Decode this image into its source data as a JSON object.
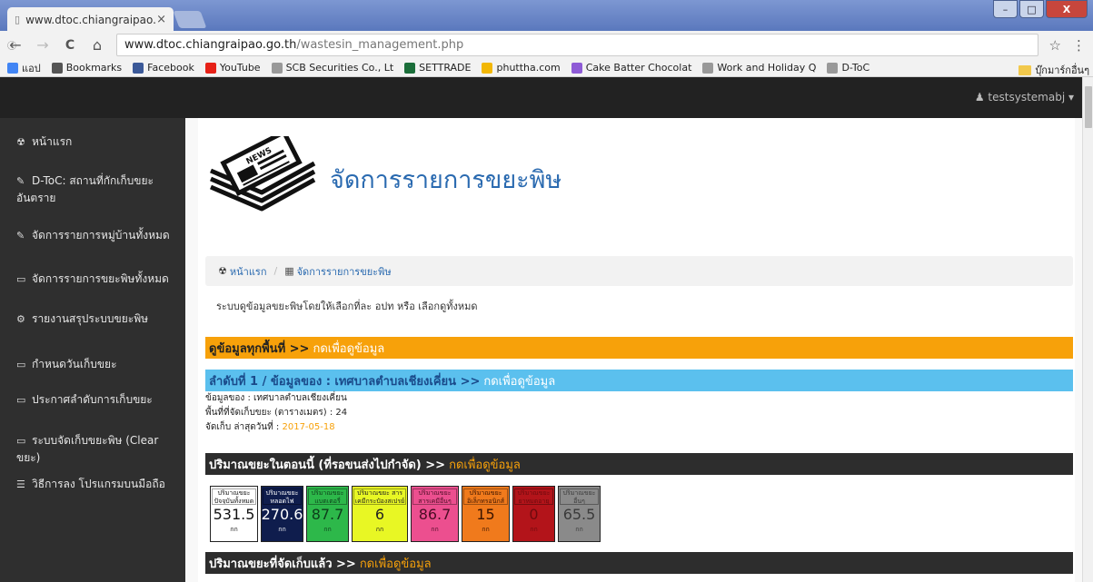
{
  "browser": {
    "tab_title": "www.dtoc.chiangraipao.g",
    "tab_close": "×",
    "window_buttons": {
      "minimize": "–",
      "restore": "□",
      "close": "X"
    },
    "url_host": "www.dtoc.chiangraipao.go.th",
    "url_path": "/wastesin_management.php",
    "info_icon": "ⓘ",
    "star": "☆",
    "menu": "⋮",
    "back": "←",
    "forward": "→",
    "reload": "C",
    "home": "⌂"
  },
  "bookmarks": {
    "items": [
      {
        "label": "แอป",
        "icon": "apps-icon",
        "color": "#4285f4"
      },
      {
        "label": "Bookmarks",
        "icon": "star-icon",
        "color": "#555555"
      },
      {
        "label": "Facebook",
        "icon": "facebook-icon",
        "color": "#3b5998"
      },
      {
        "label": "YouTube",
        "icon": "youtube-icon",
        "color": "#e62117"
      },
      {
        "label": "SCB Securities Co., Lt",
        "icon": "page-icon",
        "color": "#999999"
      },
      {
        "label": "SETTRADE",
        "icon": "settrade-icon",
        "color": "#1b6e3a"
      },
      {
        "label": "phuttha.com",
        "icon": "phuttha-icon",
        "color": "#f2b705"
      },
      {
        "label": "Cake Batter Chocolat",
        "icon": "cake-icon",
        "color": "#8e5bd6"
      },
      {
        "label": "Work and Holiday Q",
        "icon": "page-icon",
        "color": "#999999"
      },
      {
        "label": "D-ToC",
        "icon": "page-icon",
        "color": "#999999"
      }
    ],
    "other": "บุ๊กมาร์กอื่นๆ"
  },
  "navbar": {
    "user": "testsystemabj ▾"
  },
  "sidebar": {
    "items": [
      {
        "label": "หน้าแรก",
        "icon": "dashboard-icon",
        "glyph": "☢"
      },
      {
        "label": "D-ToC: สถานที่กักเก็บขยะอันตราย",
        "icon": "wrench-icon",
        "glyph": "✎"
      },
      {
        "label": "จัดการรายการหมู่บ้านทั้งหมด",
        "icon": "wrench-icon",
        "glyph": "✎"
      },
      {
        "label": "จัดการรายการขยะพิษทั้งหมด",
        "icon": "laptop-icon",
        "glyph": "▭"
      },
      {
        "label": "รายงานสรุประบบขยะพิษ",
        "icon": "gears-icon",
        "glyph": "⚙"
      },
      {
        "label": "กำหนดวันเก็บขยะ",
        "icon": "laptop-icon",
        "glyph": "▭"
      },
      {
        "label": "ประกาศลำดับการเก็บขยะ",
        "icon": "laptop-icon",
        "glyph": "▭"
      },
      {
        "label": "ระบบจัดเก็บขยะพิษ (Clear ขยะ)",
        "icon": "laptop-icon",
        "glyph": "▭"
      },
      {
        "label": "วิธีการลง โปรแกรมบนมือถือ",
        "icon": "list-icon",
        "glyph": "☰"
      }
    ]
  },
  "page": {
    "title": "จัดการรายการขยะพิษ",
    "logo_text": "NEWS",
    "breadcrumb": [
      {
        "label": "หน้าแรก",
        "glyph": "☢"
      },
      {
        "label": "จัดการรายการขยะพิษ",
        "glyph": "▦"
      }
    ],
    "description": "ระบบดูข้อมูลขยะพิษโดยให้เลือกที่ละ อปท หรือ เลือกดูทั้งหมด",
    "all_area": {
      "label": "ดูข้อมูลทุกพื้นที่ >>",
      "link": "กดเพื่อดูข้อมูล"
    },
    "rank": {
      "label": "ลำดับที่ 1 / ข้อมูลของ : เทศบาลตำบลเชียงเคี่ยน >>",
      "link": "กดเพื่อดูข้อมูล"
    },
    "info": {
      "owner": "ข้อมูลของ : เทศบาลตำบลเชียงเคี่ยน",
      "area": "พื้นที่ที่จัดเก็บขยะ (ตารางเมตร) : 24",
      "last_label": "จัดเก็บ ล่าสุดวันที่ :",
      "last_date": "2017-05-18"
    },
    "current": {
      "label": "ปริมาณขยะในตอนนี้ (ที่รอขนส่งไปกำจัด) >>",
      "link": "กดเพื่อดูข้อมูล"
    },
    "collected": {
      "label": "ปริมาณขยะที่จัดเก็บแล้ว >>",
      "link": "กดเพื่อดูข้อมูล"
    },
    "boxes": [
      {
        "label": "ปริมาณขยะ ปัจจุบันทั้งหมด",
        "value": "531.5",
        "unit": "กก",
        "bg": "#ffffff",
        "fg": "#111111"
      },
      {
        "label": "ปริมาณขยะ หลอดไฟ",
        "value": "270.6",
        "unit": "กก",
        "bg": "#0f1d4d",
        "fg": "#ffffff"
      },
      {
        "label": "ปริมาณขยะ แบตเตอรี่",
        "value": "87.7",
        "unit": "กก",
        "bg": "#2db84a",
        "fg": "#0d3d1a"
      },
      {
        "label": "ปริมาณขยะ สารเคมีกระป๋องสเปรย์",
        "value": "6",
        "unit": "กก",
        "bg": "#e8f724",
        "fg": "#222222"
      },
      {
        "label": "ปริมาณขยะ สารเคมีอื่นๆ",
        "value": "86.7",
        "unit": "กก",
        "bg": "#ec4f8f",
        "fg": "#4a0d24"
      },
      {
        "label": "ปริมาณขยะ อิเล็กทรอนิกส์",
        "value": "15",
        "unit": "กก",
        "bg": "#f07a1c",
        "fg": "#3a1400"
      },
      {
        "label": "ปริมาณขยะ ยาหมดอายุ",
        "value": "0",
        "unit": "กก",
        "bg": "#b3141a",
        "fg": "#6d0a0e"
      },
      {
        "label": "ปริมาณขยะ อื่นๆ",
        "value": "65.5",
        "unit": "กก",
        "bg": "#8a8a8a",
        "fg": "#3a3a3a"
      }
    ]
  }
}
